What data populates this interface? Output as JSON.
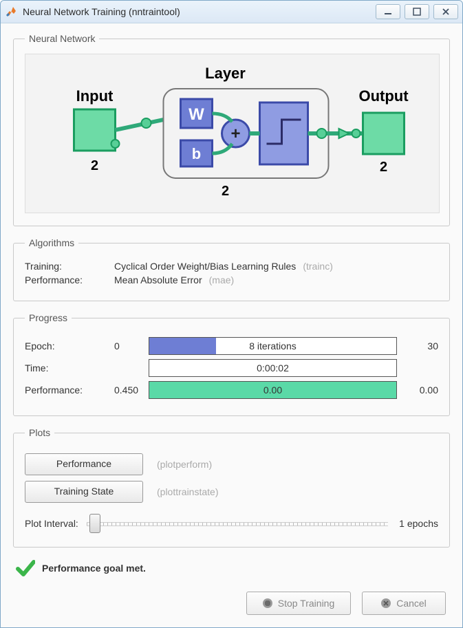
{
  "window": {
    "title": "Neural Network Training (nntraintool)"
  },
  "sections": {
    "network": "Neural Network",
    "algorithms": "Algorithms",
    "progress": "Progress",
    "plots": "Plots"
  },
  "diagram": {
    "input_label": "Input",
    "layer_label": "Layer",
    "output_label": "Output",
    "input_size": "2",
    "layer_size": "2",
    "output_size": "2",
    "w_label": "W",
    "b_label": "b",
    "plus_label": "+"
  },
  "algorithms": {
    "training_label": "Training:",
    "training_value": "Cyclical Order Weight/Bias Learning Rules",
    "training_hint": "(trainc)",
    "performance_label": "Performance:",
    "performance_value": "Mean Absolute Error",
    "performance_hint": "(mae)"
  },
  "progress": {
    "epoch_label": "Epoch:",
    "epoch_start": "0",
    "epoch_bar_text": "8 iterations",
    "epoch_end": "30",
    "epoch_fraction": 0.27,
    "time_label": "Time:",
    "time_start": "",
    "time_bar_text": "0:00:02",
    "time_end": "",
    "perf_label": "Performance:",
    "perf_start": "0.450",
    "perf_bar_text": "0.00",
    "perf_end": "0.00",
    "colors": {
      "epoch_fill": "#6e7ed4",
      "perf_fill": "#5ad9a7"
    }
  },
  "plots": {
    "performance_btn": "Performance",
    "performance_hint": "(plotperform)",
    "training_state_btn": "Training State",
    "training_state_hint": "(plottrainstate)",
    "interval_label": "Plot Interval:",
    "interval_value": "1 epochs"
  },
  "status": {
    "message": "Performance goal met."
  },
  "footer": {
    "stop": "Stop Training",
    "cancel": "Cancel"
  }
}
